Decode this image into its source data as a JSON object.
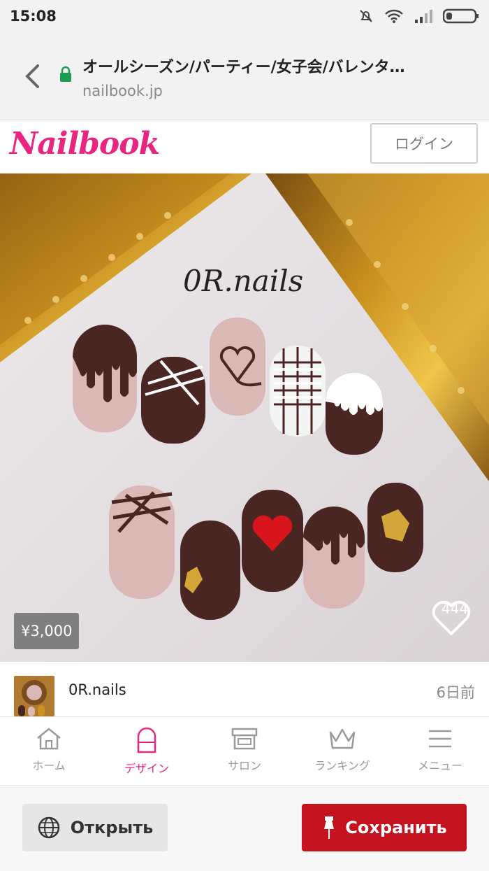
{
  "status_bar": {
    "time": "15:08"
  },
  "browser": {
    "page_title": "オールシーズン/パーティー/女子会/バレンタ…",
    "url": "nailbook.jp"
  },
  "site": {
    "logo_text": "Nailbook",
    "login_label": "ログイン"
  },
  "post": {
    "image_watermark": "0R.nails",
    "price": "¥3,000",
    "like_count": "444",
    "author": "0R.nails",
    "posted": "6日前"
  },
  "nav": {
    "items": [
      {
        "label": "ホーム",
        "icon": "home-icon"
      },
      {
        "label": "デザイン",
        "icon": "nail-icon",
        "active": true
      },
      {
        "label": "サロン",
        "icon": "shop-icon"
      },
      {
        "label": "ランキング",
        "icon": "crown-icon"
      },
      {
        "label": "メニュー",
        "icon": "menu-icon"
      }
    ]
  },
  "actions": {
    "open_label": "Открыть",
    "save_label": "Сохранить"
  },
  "colors": {
    "brand_pink": "#e8267f",
    "save_red": "#c4121e",
    "chocolate": "#4a2622",
    "nude": "#d9b8b6"
  }
}
